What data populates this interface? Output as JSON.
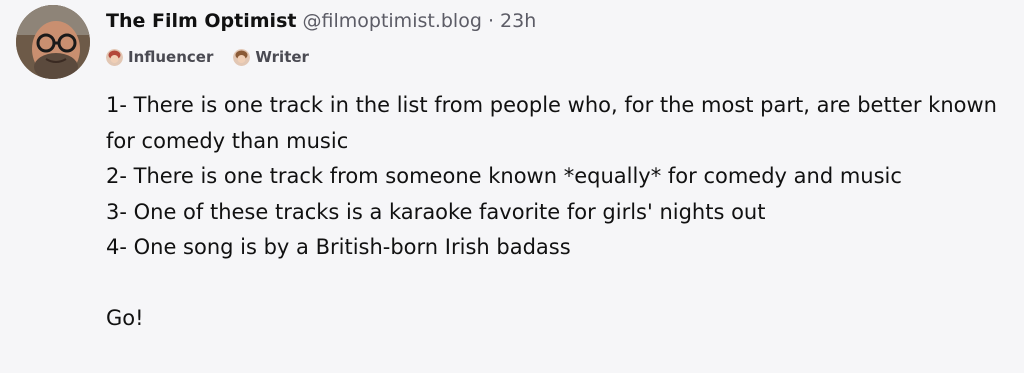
{
  "author": {
    "display_name": "The Film Optimist",
    "handle": "@filmoptimist.blog",
    "separator": "·",
    "timestamp": "23h"
  },
  "badges": [
    {
      "label": "Influencer",
      "icon": "influencer-avatar-icon"
    },
    {
      "label": "Writer",
      "icon": "writer-avatar-icon"
    }
  ],
  "body": {
    "line1": "1- There is one track in the list from people who, for the most part, are better known for comedy than music",
    "line2": "2- There is one track from someone known *equally* for comedy and music",
    "line3": "3- One of these tracks is a karaoke favorite for girls' nights out",
    "line4": "4- One song is by a British-born Irish badass",
    "closing": "Go!"
  },
  "colors": {
    "background": "#f6f6f8",
    "text": "#111111",
    "muted": "#5c5c66"
  }
}
